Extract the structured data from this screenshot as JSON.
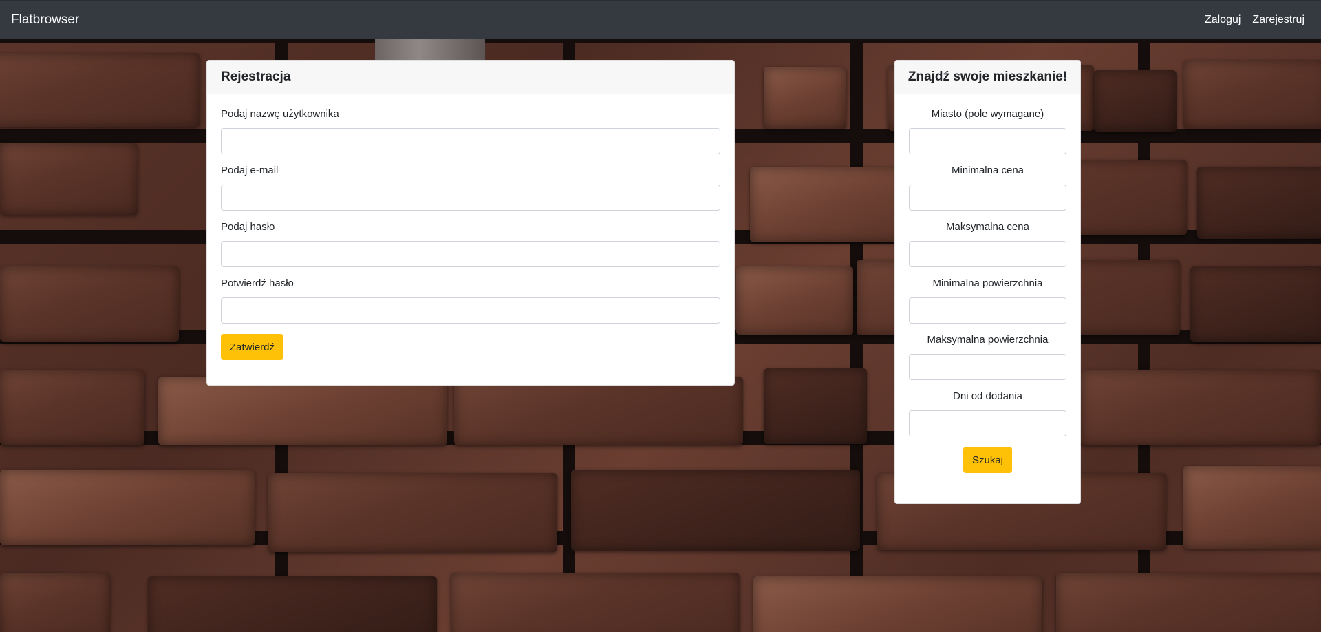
{
  "navbar": {
    "brand": "Flatbrowser",
    "links": [
      {
        "label": "Zaloguj"
      },
      {
        "label": "Zarejestruj"
      }
    ]
  },
  "register": {
    "title": "Rejestracja",
    "fields": {
      "username": {
        "label": "Podaj nazwę użytkownika",
        "value": ""
      },
      "email": {
        "label": "Podaj e-mail",
        "value": ""
      },
      "password": {
        "label": "Podaj hasło",
        "value": ""
      },
      "confirm_password": {
        "label": "Potwierdź hasło",
        "value": ""
      }
    },
    "submit_label": "Zatwierdź"
  },
  "search": {
    "title": "Znajdź swoje mieszkanie!",
    "fields": {
      "city": {
        "label": "Miasto (pole wymagane)",
        "value": ""
      },
      "min_price": {
        "label": "Minimalna cena",
        "value": ""
      },
      "max_price": {
        "label": "Maksymalna cena",
        "value": ""
      },
      "min_area": {
        "label": "Minimalna powierzchnia",
        "value": ""
      },
      "max_area": {
        "label": "Maksymalna powierzchnia",
        "value": ""
      },
      "days_since_added": {
        "label": "Dni od dodania",
        "value": ""
      }
    },
    "submit_label": "Szukaj"
  },
  "colors": {
    "navbar": "#343a40",
    "accent": "#ffc107",
    "background": "#5a3328"
  }
}
